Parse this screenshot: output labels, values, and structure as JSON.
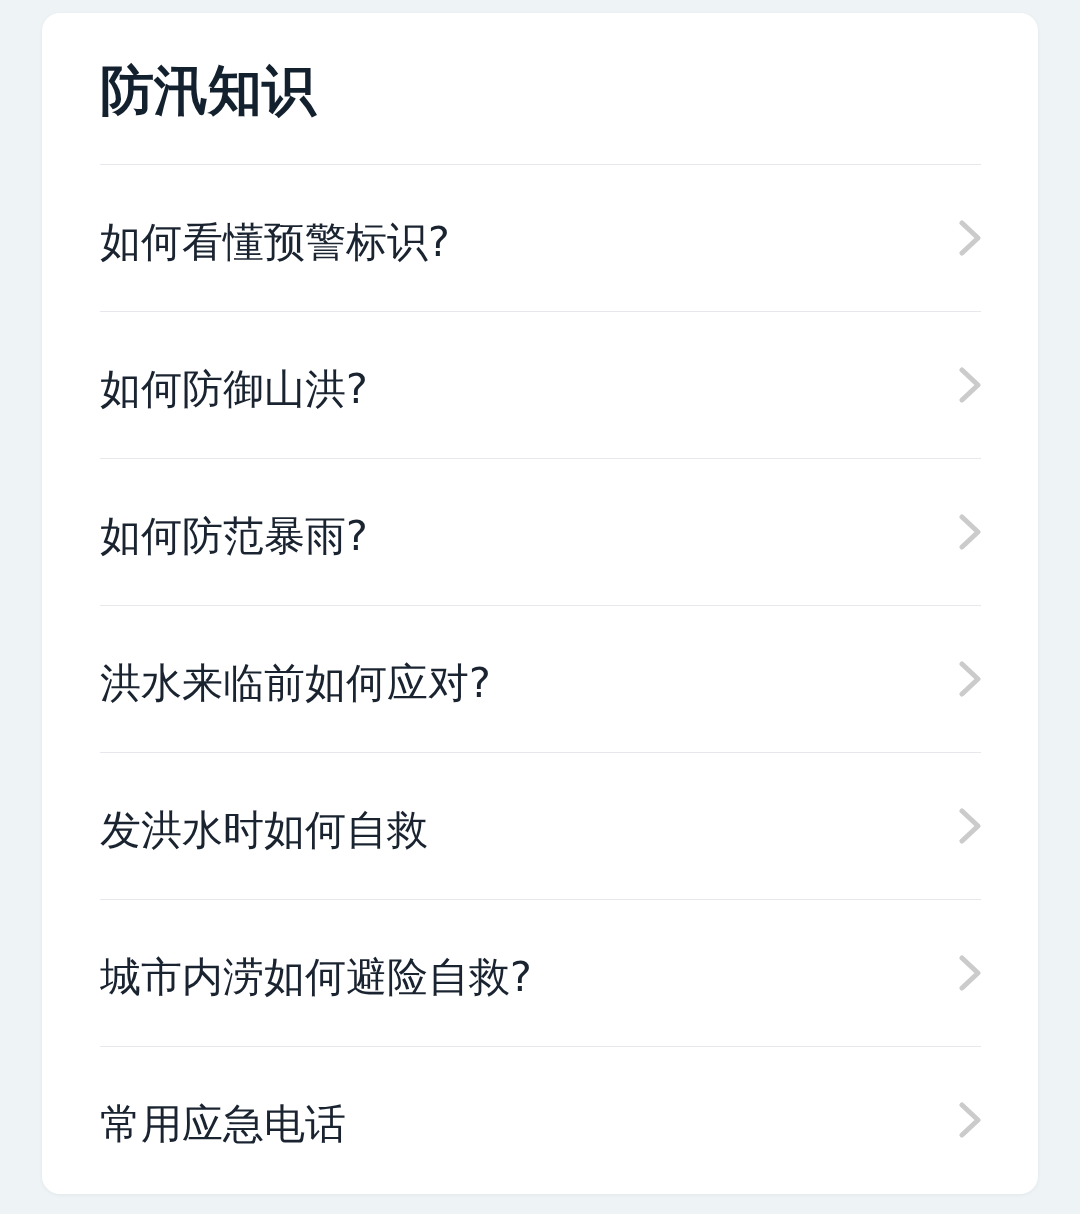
{
  "title": "防汛知识",
  "items": [
    {
      "label": "如何看懂预警标识?"
    },
    {
      "label": "如何防御山洪?"
    },
    {
      "label": "如何防范暴雨?"
    },
    {
      "label": "洪水来临前如何应对?"
    },
    {
      "label": "发洪水时如何自救"
    },
    {
      "label": "城市内涝如何避险自救?"
    },
    {
      "label": "常用应急电话"
    }
  ]
}
